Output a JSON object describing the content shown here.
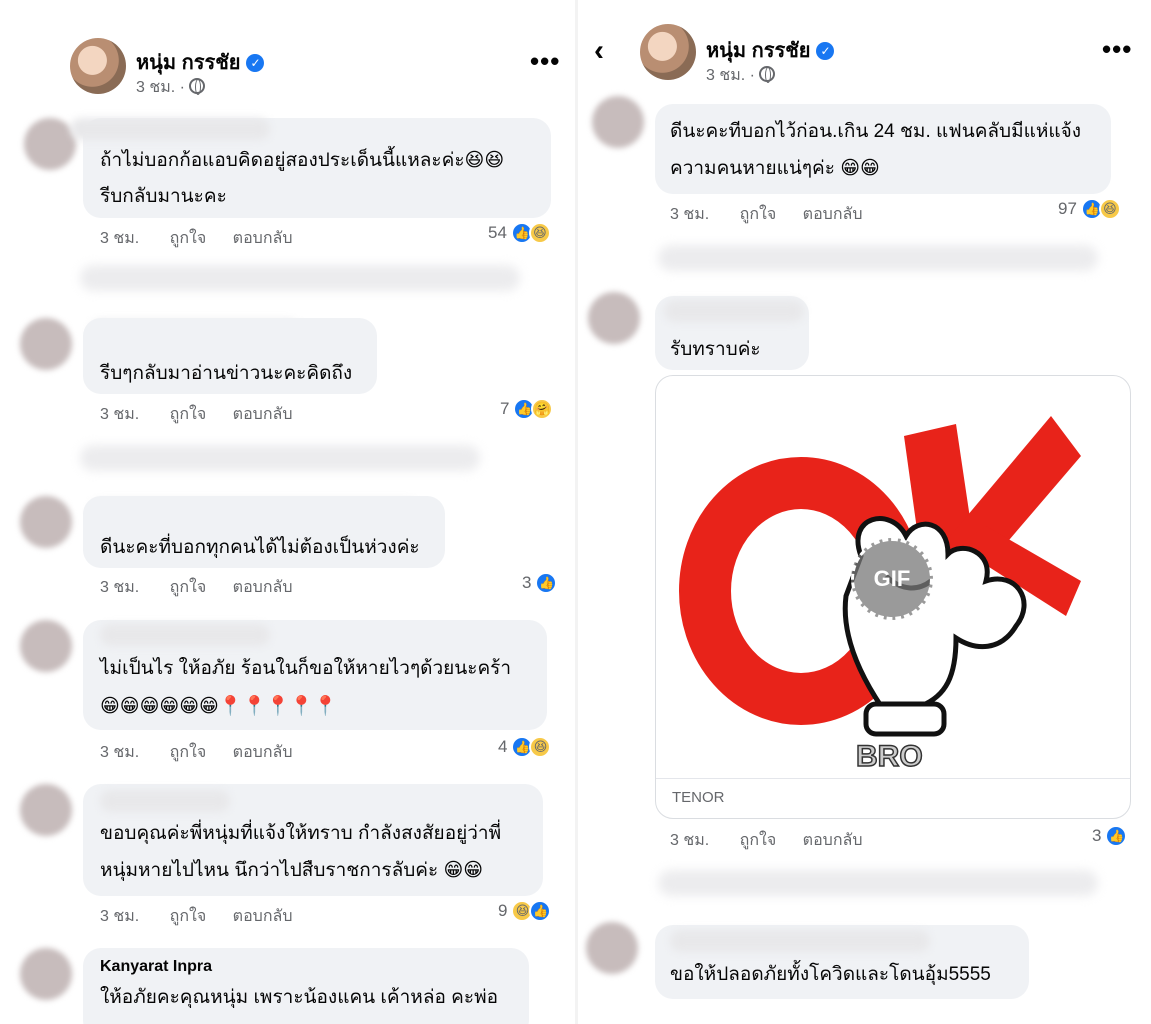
{
  "post": {
    "author": "หนุ่ม กรรชัย",
    "time": "3 ชม. ·",
    "more": "•••",
    "back": "‹"
  },
  "actions": {
    "like": "ถูกใจ",
    "reply": "ตอบกลับ"
  },
  "left_comments": [
    {
      "lines": [
        "ถ้าไม่บอกก้อแอบคิดอยู่สองประเด็นนี้แหละค่ะ😆😆",
        "รีบกลับมานะคะ"
      ],
      "time": "3 ชม.",
      "count": "54",
      "reactions": [
        "like-icon",
        "haha-icon"
      ]
    },
    {
      "lines": [
        "รีบๆกลับมาอ่านข่าวนะคะคิดถึง"
      ],
      "time": "3 ชม.",
      "count": "7",
      "reactions": [
        "like-icon",
        "care-icon"
      ]
    },
    {
      "lines": [
        "ดีนะคะที่บอกทุกคนได้ไม่ต้องเป็นห่วงค่ะ"
      ],
      "time": "3 ชม.",
      "count": "3",
      "reactions": [
        "like-icon"
      ]
    },
    {
      "lines": [
        "ไม่เป็นไร ให้อภัย ร้อนในก็ขอให้หายไวๆด้วยนะคร้า",
        "😁😁😁😁😁😁📍📍📍📍📍"
      ],
      "time": "3 ชม.",
      "count": "4",
      "reactions": [
        "like-icon",
        "haha-icon"
      ]
    },
    {
      "lines": [
        "ขอบคุณค่ะพี่หนุ่มที่แจ้งให้ทราบ  กำลังสงสัยอยู่ว่าพี่",
        "หนุ่มหายไปไหน นึกว่าไปสืบราชการลับค่ะ 😁😁"
      ],
      "time": "3 ชม.",
      "count": "9",
      "reactions": [
        "haha-icon",
        "like-icon"
      ]
    },
    {
      "name": "Kanyarat Inpra",
      "lines": [
        "ให้อภัยคะคุณหนุ่ม เพราะน้องแคน เค้าหล่อ คะพ่อ"
      ]
    }
  ],
  "right_comments": [
    {
      "lines": [
        "ดีนะคะทีบอกไว้ก่อน.เกิน 24 ชม. แฟนคลับมีแห่แจ้ง",
        "ความคนหายแน่ๆค่ะ 😁😁"
      ],
      "time": "3 ชม.",
      "count": "97",
      "reactions": [
        "like-icon",
        "haha-icon"
      ]
    },
    {
      "lines": [
        "รับทราบค่ะ"
      ],
      "time": "3 ชม.",
      "count": "3",
      "reactions": [
        "like-icon"
      ],
      "gif": {
        "text": "OK",
        "brand": "BRO",
        "badge": "GIF",
        "source": "TENOR",
        "accent": "#e8231a"
      }
    },
    {
      "lines": [
        "ขอให้ปลอดภัยทั้งโควิดและโดนอุ้ม5555"
      ]
    }
  ],
  "colors": {
    "bubble": "#f0f2f5",
    "meta": "#65676b",
    "brand_blue": "#1877f2",
    "ok_red": "#e8231a"
  }
}
